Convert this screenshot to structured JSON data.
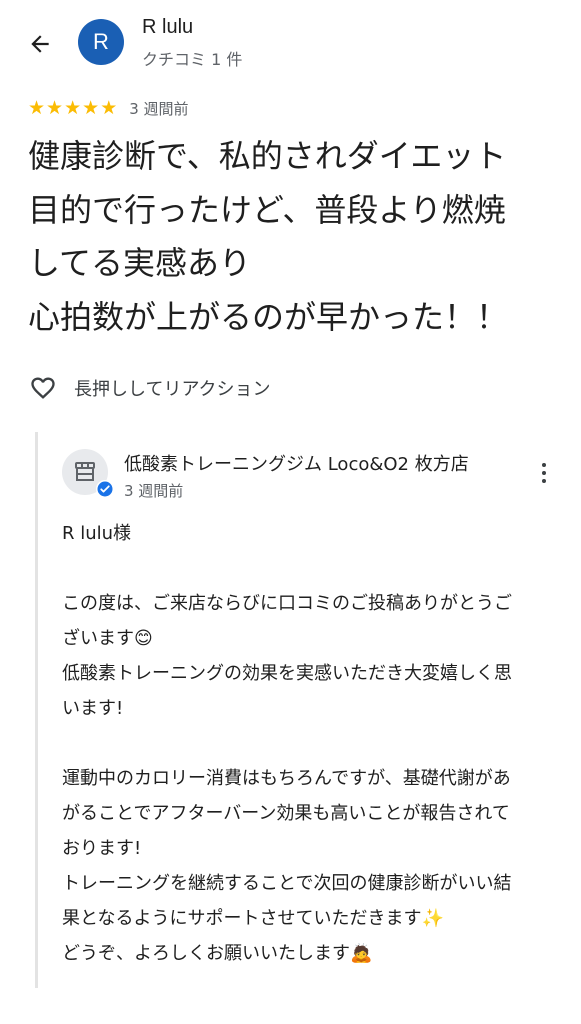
{
  "header": {
    "back_icon": "arrow-left-icon",
    "avatar_letter": "R",
    "avatar_color": "#1a5fb4",
    "author_name": "R lulu",
    "author_sub": "クチコミ 1 件"
  },
  "review": {
    "rating": 5,
    "stars": [
      "★",
      "★",
      "★",
      "★",
      "★"
    ],
    "star_color": "#fbbc04",
    "time": "3 週間前",
    "text": "健康診断で、私的されダイエット\n目的で行ったけど、普段より燃焼\nしてる実感あり\n心拍数が上がるのが早かった！！"
  },
  "reaction": {
    "icon": "heart-outline-icon",
    "label": "長押ししてリアクション"
  },
  "owner_reply": {
    "icon": "storefront-icon",
    "verified_icon": "verified-badge-icon",
    "name": "低酸素トレーニングジム Loco&O2 枚方店",
    "time": "3 週間前",
    "more_icon": "more-vert-icon",
    "text": "R lulu様\n\nこの度は、ご来店ならびに口コミのご投稿ありがとうご\nざいます😊\n低酸素トレーニングの効果を実感いただき大変嬉しく思\nいます!\n\n運動中のカロリー消費はもちろんですが、基礎代謝があ\nがることでアフターバーン効果も高いことが報告されて\nおります!\nトレーニングを継続することで次回の健康診断がいい結\n果となるようにサポートさせていただきます✨\nどうぞ、よろしくお願いいたします🙇"
  }
}
